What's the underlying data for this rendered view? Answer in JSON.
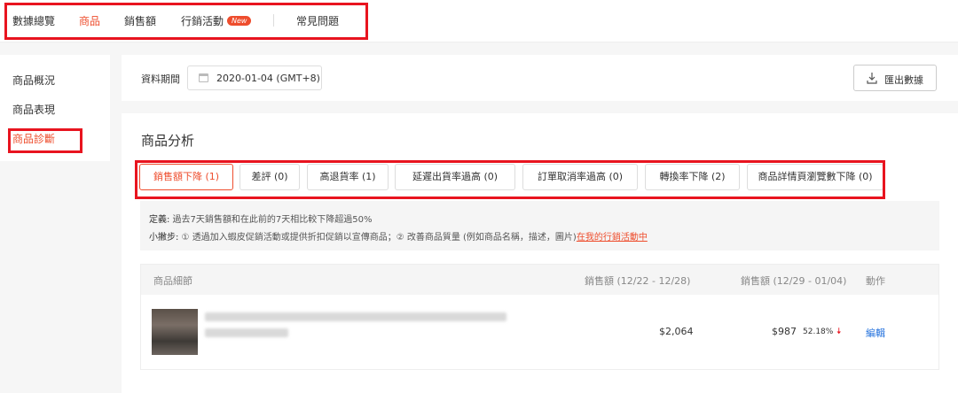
{
  "topnav": {
    "items": [
      {
        "label": "數據總覽"
      },
      {
        "label": "商品"
      },
      {
        "label": "銷售額"
      },
      {
        "label": "行銷活動",
        "badge": "New"
      },
      {
        "label": "常見問題"
      }
    ]
  },
  "sidebar": {
    "items": [
      {
        "label": "商品概況"
      },
      {
        "label": "商品表現"
      },
      {
        "label": "商品診斷"
      }
    ]
  },
  "period": {
    "label": "資料期間",
    "date": "2020-01-04 (GMT+8)",
    "export_label": "匯出數據"
  },
  "analysis": {
    "title": "商品分析",
    "tabs": [
      {
        "label": "銷售額下降 (1)"
      },
      {
        "label": "差評 (0)"
      },
      {
        "label": "高退貨率 (1)"
      },
      {
        "label": "延遲出貨率過高 (0)"
      },
      {
        "label": "訂單取消率過高 (0)"
      },
      {
        "label": "轉換率下降 (2)"
      },
      {
        "label": "商品詳情頁瀏覽數下降 (0)"
      }
    ],
    "definition_label": "定義:",
    "definition_text": " 過去7天銷售額和在此前的7天相比較下降超過50%",
    "tip_label": "小撇步:",
    "tip_text": " ① 透過加入蝦皮促銷活動或提供折扣促銷以宣傳商品；② 改善商品質量 (例如商品名稱，描述，圖片)",
    "tip_link": "在我的行銷活動中"
  },
  "table": {
    "headers": {
      "detail": "商品細節",
      "sales_prev": "銷售額 (12/22 - 12/28)",
      "sales_curr": "銷售額 (12/29 - 01/04)",
      "action": "動作"
    },
    "rows": [
      {
        "sales_prev": "$2,064",
        "sales_curr": "$987",
        "change": "52.18%",
        "action": "編輯"
      }
    ]
  },
  "colors": {
    "accent": "#ee4d2d",
    "highlight_box": "#e8141f",
    "link": "#2673dd"
  }
}
